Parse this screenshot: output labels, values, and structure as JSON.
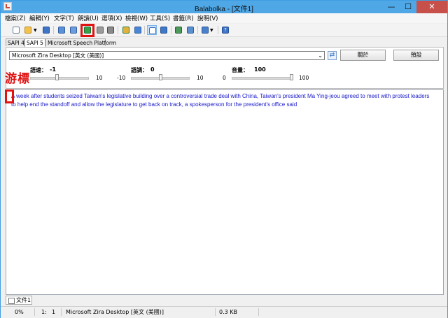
{
  "window": {
    "title": "Balabolka - [文件1]",
    "buttons": {
      "minimize": "—",
      "maximize": "☐",
      "close": "✕"
    }
  },
  "menu": [
    "檔案(Z)",
    "編輯(Y)",
    "文字(T)",
    "朗讀(U)",
    "選項(X)",
    "檢視(W)",
    "工具(S)",
    "書籤(R)",
    "說明(V)"
  ],
  "toolbar": {
    "icons": [
      "new-document-icon",
      "open-folder-icon",
      "dropdown-arrow-icon",
      "save-icon",
      "read-clipboard-icon",
      "read-file-icon",
      "play-icon",
      "pause-icon",
      "stop-icon",
      "save-audio-icon",
      "split-icon",
      "text-view-icon",
      "dictionary-icon",
      "spell-check-icon",
      "convert-icon",
      "bookmarks-icon",
      "bookmarks-dropdown-icon",
      "help-icon"
    ],
    "highlighted": "play-icon"
  },
  "tabs": [
    "SAPI 4",
    "SAPI 5",
    "Microsoft Speech Platform"
  ],
  "active_tab": "SAPI 5",
  "voice": {
    "selected": "Microsoft Zira Desktop [英文 (美國)]",
    "about_button": "關於",
    "settings_button": "預設"
  },
  "sliders": {
    "rate": {
      "label": "語速：",
      "value": "-1",
      "min": "-10",
      "max": "10",
      "fraction": 0.45
    },
    "pitch": {
      "label": "語調：",
      "value": "0",
      "min": "-10",
      "max": "10",
      "fraction": 0.5
    },
    "volume": {
      "label": "音量：",
      "value": "100",
      "min": "0",
      "max": "100",
      "fraction": 1.0
    }
  },
  "annotation": {
    "text": "游標",
    "color": "#e01212"
  },
  "editor": {
    "text": "A week after students seized Taiwan's legislative building over a controversial trade deal with China, Taiwan's president Ma Ying-jeou agreed to meet with protest leaders to help end the standoff and allow the legislature to get back on track, a spokesperson for the president's office said",
    "text_color": "#1a1aca"
  },
  "document_tab": "文件1",
  "status": {
    "progress": "0%",
    "position": "1:",
    "line": "1",
    "voice": "Microsoft Zira Desktop [英文 (美國)]",
    "size": "0.3 KB"
  }
}
